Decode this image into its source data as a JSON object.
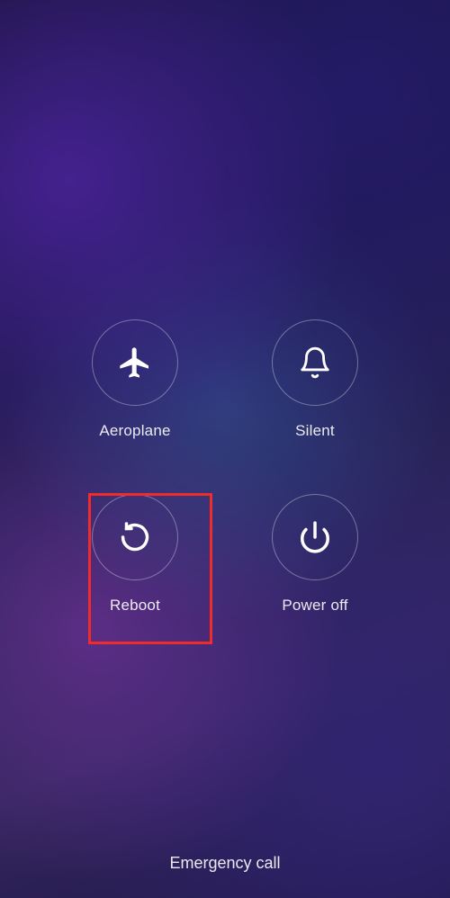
{
  "powerMenu": {
    "aeroplane": {
      "label": "Aeroplane"
    },
    "silent": {
      "label": "Silent"
    },
    "reboot": {
      "label": "Reboot"
    },
    "poweroff": {
      "label": "Power off"
    }
  },
  "emergency": {
    "label": "Emergency call"
  }
}
